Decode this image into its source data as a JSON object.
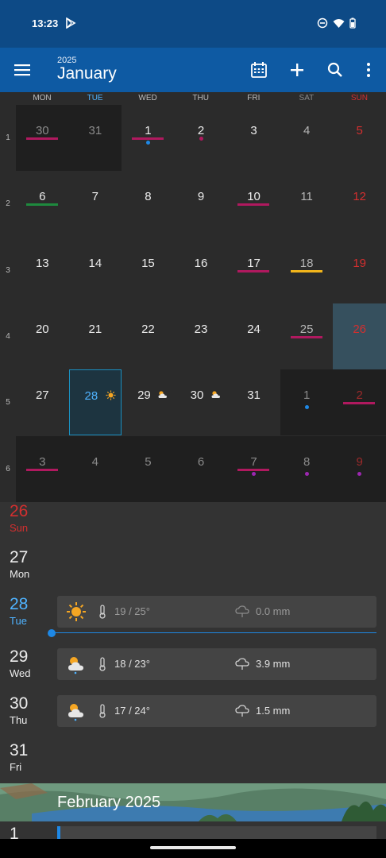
{
  "status_bar": {
    "time": "13:23"
  },
  "app_bar": {
    "year": "2025",
    "month": "January"
  },
  "weekdays": [
    "MON",
    "TUE",
    "WED",
    "THU",
    "FRI",
    "SAT",
    "SUN"
  ],
  "week_numbers": [
    "1",
    "2",
    "3",
    "4",
    "5",
    "6"
  ],
  "calendar": [
    [
      "30",
      "31",
      "1",
      "2",
      "3",
      "4",
      "5"
    ],
    [
      "6",
      "7",
      "8",
      "9",
      "10",
      "11",
      "12"
    ],
    [
      "13",
      "14",
      "15",
      "16",
      "17",
      "18",
      "19"
    ],
    [
      "20",
      "21",
      "22",
      "23",
      "24",
      "25",
      "26"
    ],
    [
      "27",
      "28",
      "29",
      "30",
      "31",
      "1",
      "2"
    ],
    [
      "3",
      "4",
      "5",
      "6",
      "7",
      "8",
      "9"
    ]
  ],
  "colors": {
    "accent": "#1e88e5",
    "sunday": "#d32f2f",
    "event_magenta": "#b0195f",
    "event_green": "#1e8a3e",
    "event_yellow": "#f2b51b",
    "event_purple": "#9c27b0"
  },
  "agenda": {
    "days": [
      {
        "num": "26",
        "name": "Sun"
      },
      {
        "num": "27",
        "name": "Mon"
      },
      {
        "num": "28",
        "name": "Tue"
      },
      {
        "num": "29",
        "name": "Wed"
      },
      {
        "num": "30",
        "name": "Thu"
      },
      {
        "num": "31",
        "name": "Fri"
      }
    ],
    "weather": [
      {
        "icon": "sun-icon",
        "temp": "19 / 25°",
        "rain": "0.0 mm"
      },
      {
        "icon": "partly-cloudy-rain-icon",
        "temp": "18 / 23°",
        "rain": "3.9 mm"
      },
      {
        "icon": "partly-cloudy-rain-icon",
        "temp": "17 / 24°",
        "rain": "1.5 mm"
      }
    ]
  },
  "next_month": {
    "title": "February 2025",
    "first_day": "1"
  }
}
